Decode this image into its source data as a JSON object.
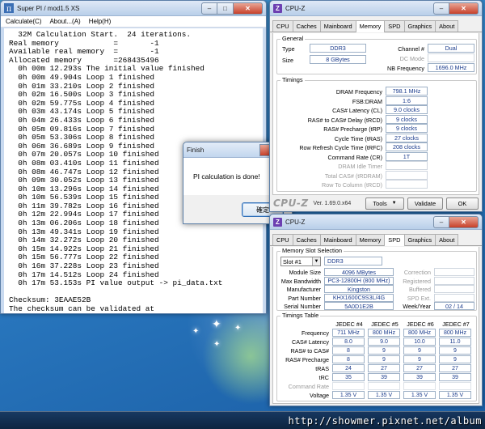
{
  "superpi": {
    "title": "Super PI / mod1.5 XS",
    "menu": [
      "Calculate(C)",
      "About...(A)",
      "Help(H)"
    ],
    "console_lines": [
      "  32M Calculation Start.  24 iterations.",
      "Real memory            =       -1",
      "Available real memory  =       -1",
      "Allocated memory       =268435496",
      "  0h 00m 12.293s The initial value finished",
      "  0h 00m 49.904s Loop 1 finished",
      "  0h 01m 33.210s Loop 2 finished",
      "  0h 02m 16.500s Loop 3 finished",
      "  0h 02m 59.775s Loop 4 finished",
      "  0h 03m 43.174s Loop 5 finished",
      "  0h 04m 26.433s Loop 6 finished",
      "  0h 05m 09.816s Loop 7 finished",
      "  0h 05m 53.306s Loop 8 finished",
      "  0h 06m 36.689s Loop 9 finished",
      "  0h 07m 20.057s Loop 10 finished",
      "  0h 08m 03.410s Loop 11 finished",
      "  0h 08m 46.747s Loop 12 finished",
      "  0h 09m 30.052s Loop 13 finished",
      "  0h 10m 13.296s Loop 14 finished",
      "  0h 10m 56.539s Loop 15 finished",
      "  0h 11m 39.782s Loop 16 finished",
      "  0h 12m 22.994s Loop 17 finished",
      "  0h 13m 06.206s Loop 18 finished",
      "  0h 13m 49.341s Loop 19 finished",
      "  0h 14m 32.272s Loop 20 finished",
      "  0h 15m 14.922s Loop 21 finished",
      "  0h 15m 56.777s Loop 22 finished",
      "  0h 16m 37.228s Loop 23 finished",
      "  0h 17m 14.512s Loop 24 finished",
      "  0h 17m 53.153s PI value output -> pi_data.txt",
      "",
      "Checksum: 3EAAE52B",
      "The checksum can be validated at"
    ]
  },
  "finish": {
    "title": "Finish",
    "message": "PI calculation is done!",
    "ok_label": "確定"
  },
  "cpuz_memory": {
    "title": "CPU-Z",
    "tabs": [
      "CPU",
      "Caches",
      "Mainboard",
      "Memory",
      "SPD",
      "Graphics",
      "About"
    ],
    "general_label": "General",
    "type_label": "Type",
    "type_value": "DDR3",
    "size_label": "Size",
    "size_value": "8 GBytes",
    "channel_label": "Channel #",
    "channel_value": "Dual",
    "dcmode_label": "DC Mode",
    "dcmode_value": "",
    "nbfreq_label": "NB Frequency",
    "nbfreq_value": "1696.0 MHz",
    "timings_label": "Timings",
    "timings": [
      {
        "label": "DRAM Frequency",
        "value": "798.1 MHz",
        "dim": false
      },
      {
        "label": "FSB:DRAM",
        "value": "1:6",
        "dim": false
      },
      {
        "label": "CAS# Latency (CL)",
        "value": "9.0 clocks",
        "dim": false
      },
      {
        "label": "RAS# to CAS# Delay (tRCD)",
        "value": "9 clocks",
        "dim": false
      },
      {
        "label": "RAS# Precharge (tRP)",
        "value": "9 clocks",
        "dim": false
      },
      {
        "label": "Cycle Time (tRAS)",
        "value": "27 clocks",
        "dim": false
      },
      {
        "label": "Row Refresh Cycle Time (tRFC)",
        "value": "208 clocks",
        "dim": false
      },
      {
        "label": "Command Rate (CR)",
        "value": "1T",
        "dim": false
      },
      {
        "label": "DRAM Idle Timer",
        "value": "",
        "dim": true
      },
      {
        "label": "Total CAS# (tRDRAM)",
        "value": "",
        "dim": true
      },
      {
        "label": "Row To Column (tRCD)",
        "value": "",
        "dim": true
      }
    ],
    "logo": "CPU-Z",
    "version": "Ver. 1.69.0.x64",
    "tools_label": "Tools",
    "validate_label": "Validate",
    "ok_label": "OK"
  },
  "cpuz_spd": {
    "title": "CPU-Z",
    "tabs": [
      "CPU",
      "Caches",
      "Mainboard",
      "Memory",
      "SPD",
      "Graphics",
      "About"
    ],
    "slot_group_label": "Memory Slot Selection",
    "slot_value": "Slot #1",
    "slot_type": "DDR3",
    "left_fields": [
      {
        "label": "Module Size",
        "value": "4096 MBytes"
      },
      {
        "label": "Max Bandwidth",
        "value": "PC3-12800H (800 MHz)"
      },
      {
        "label": "Manufacturer",
        "value": "Kingston"
      },
      {
        "label": "Part Number",
        "value": "KHX1600C9S3L/4G"
      },
      {
        "label": "Serial Number",
        "value": "5A0D1E2B"
      }
    ],
    "right_fields": [
      {
        "label": "Correction",
        "value": ""
      },
      {
        "label": "Registered",
        "value": ""
      },
      {
        "label": "Buffered",
        "value": ""
      },
      {
        "label": "SPD Ext.",
        "value": ""
      },
      {
        "label": "Week/Year",
        "value": "02 / 14"
      }
    ],
    "timings_table_label": "Timings Table",
    "columns": [
      "JEDEC #4",
      "JEDEC #5",
      "JEDEC #6",
      "JEDEC #7"
    ],
    "rows": [
      {
        "label": "Frequency",
        "values": [
          "711 MHz",
          "800 MHz",
          "800 MHz",
          "800 MHz"
        ]
      },
      {
        "label": "CAS# Latency",
        "values": [
          "8.0",
          "9.0",
          "10.0",
          "11.0"
        ]
      },
      {
        "label": "RAS# to CAS#",
        "values": [
          "8",
          "9",
          "9",
          "9"
        ]
      },
      {
        "label": "RAS# Precharge",
        "values": [
          "8",
          "9",
          "9",
          "9"
        ]
      },
      {
        "label": "tRAS",
        "values": [
          "24",
          "27",
          "27",
          "27"
        ]
      },
      {
        "label": "tRC",
        "values": [
          "35",
          "39",
          "39",
          "39"
        ]
      },
      {
        "label": "Command Rate",
        "values": [
          "",
          "",
          "",
          ""
        ]
      },
      {
        "label": "Voltage",
        "values": [
          "1.35 V",
          "1.35 V",
          "1.35 V",
          "1.35 V"
        ]
      }
    ]
  },
  "watermark": "http://showmer.pixnet.net/album",
  "colors": {
    "desktop": "#2a79c0",
    "value_text": "#1a3b8c",
    "close_button": "#c7402a"
  }
}
